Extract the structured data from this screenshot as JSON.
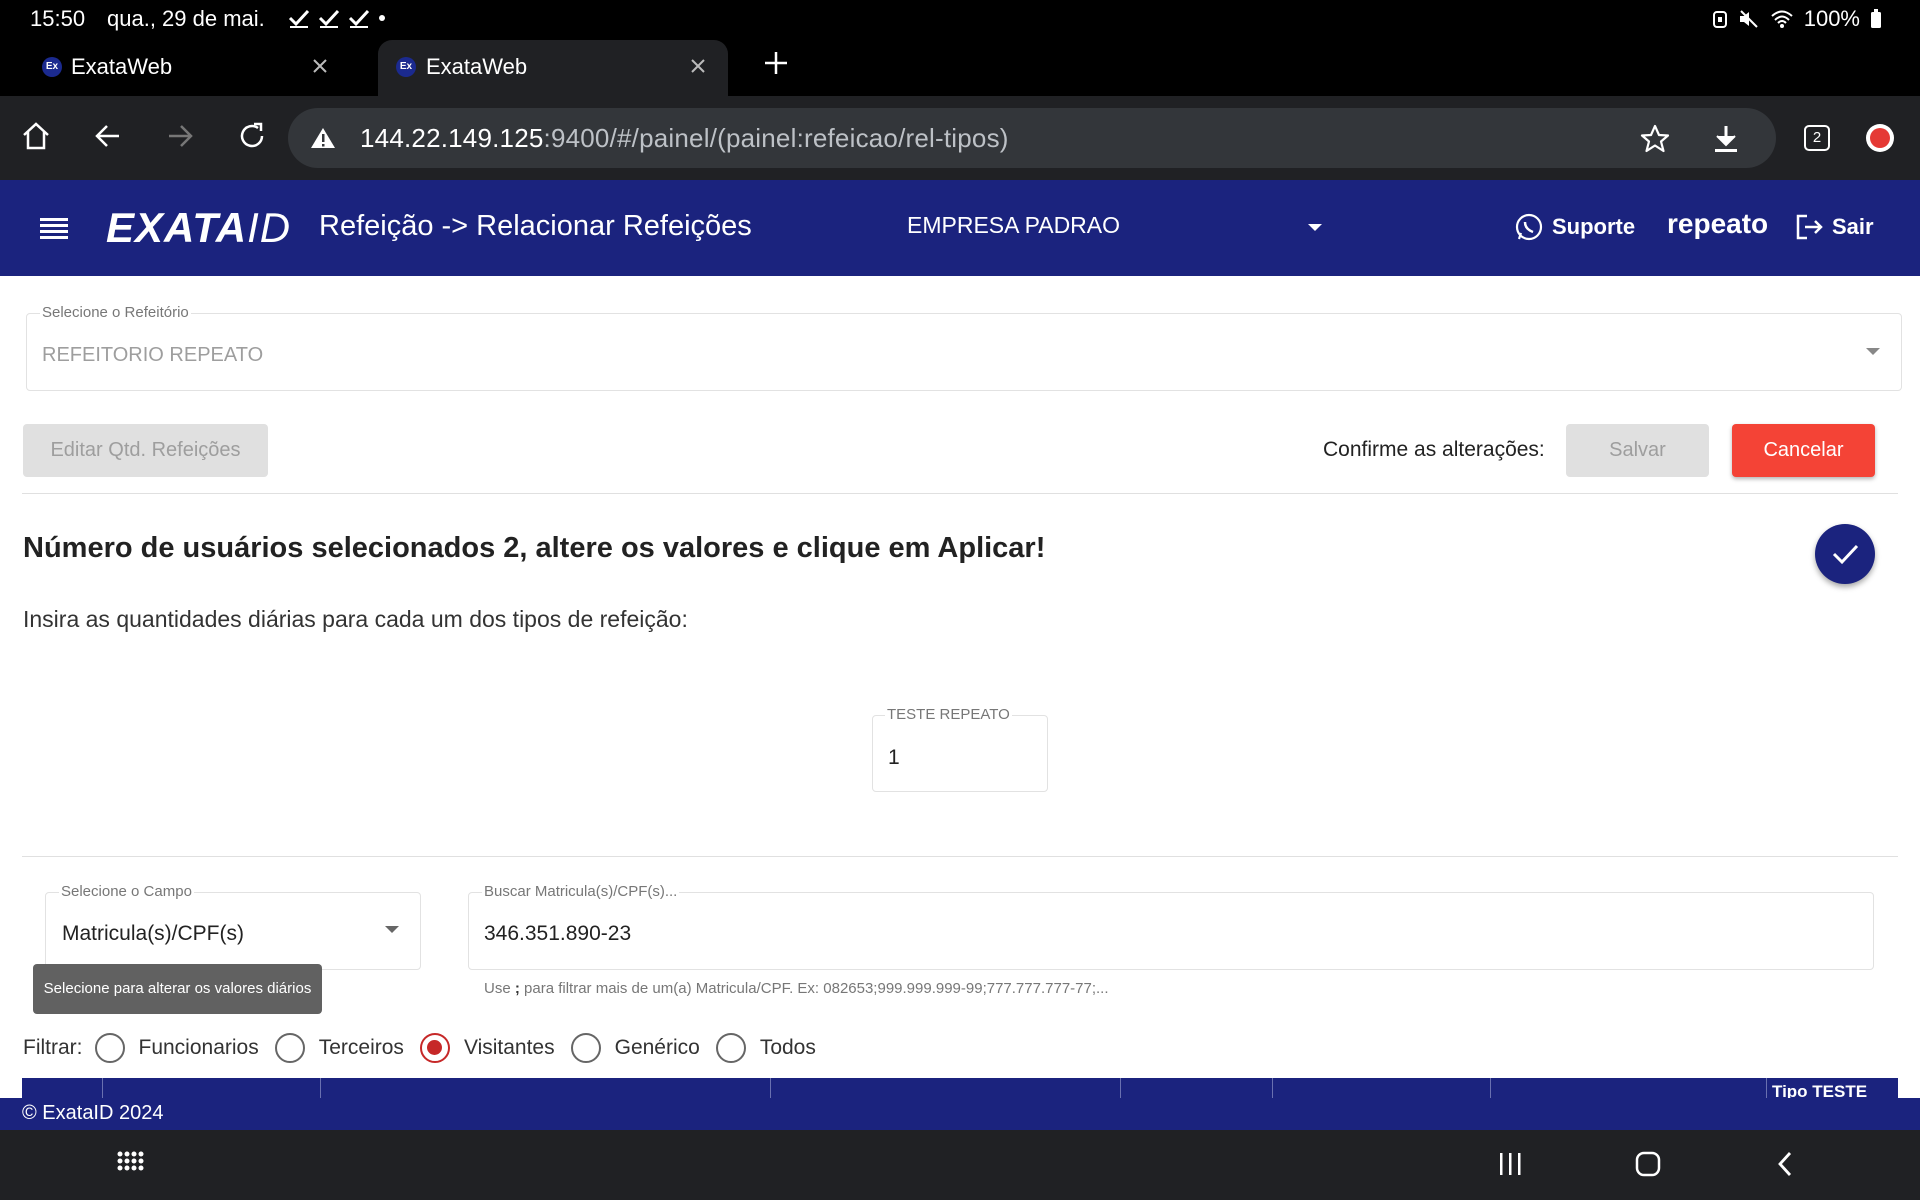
{
  "status_bar": {
    "time": "15:50",
    "date": "qua., 29 de mai.",
    "battery": "100%"
  },
  "browser": {
    "tabs": [
      {
        "title": "ExataWeb",
        "favicon": "Ex"
      },
      {
        "title": "ExataWeb",
        "favicon": "Ex"
      }
    ],
    "url_host": "144.22.149.125",
    "url_rest": ":9400/#/painel/(painel:refeicao/rel-tipos)",
    "tab_count": "2"
  },
  "header": {
    "logo": "EXATAID",
    "page_title": "Refeição -> Relacionar Refeições",
    "company": "EMPRESA PADRAO",
    "support_label": "Suporte",
    "username": "repeato",
    "logout_label": "Sair"
  },
  "refeitorio": {
    "label": "Selecione o Refeitório",
    "value": "REFEITORIO REPEATO"
  },
  "actions": {
    "edit_label": "Editar Qtd. Refeições",
    "confirm_text": "Confirme as alterações:",
    "save_label": "Salvar",
    "cancel_label": "Cancelar"
  },
  "content": {
    "heading": "Número de usuários selecionados 2, altere os valores e clique em Aplicar!",
    "subheading": "Insira as quantidades diárias para cada um dos tipos de refeição:",
    "quantity_label": "TESTE REPEATO",
    "quantity_value": "1"
  },
  "search": {
    "field_label": "Selecione o Campo",
    "field_value": "Matricula(s)/CPF(s)",
    "query_label": "Buscar Matricula(s)/CPF(s)...",
    "query_value": "346.351.890-23",
    "hint_prefix": "Use ",
    "hint_sep": ";",
    "hint_suffix": " para filtrar mais de um(a) Matricula/CPF. Ex: 082653;999.999.999-99;777.777.777-77;...",
    "tooltip": "Selecione para alterar os valores diários"
  },
  "filter": {
    "label": "Filtrar:",
    "options": [
      {
        "label": "Funcionarios",
        "selected": false
      },
      {
        "label": "Terceiros",
        "selected": false
      },
      {
        "label": "Visitantes",
        "selected": true
      },
      {
        "label": "Genérico",
        "selected": false
      },
      {
        "label": "Todos",
        "selected": false
      }
    ]
  },
  "table": {
    "last_column": "Tipo TESTE"
  },
  "footer": {
    "copyright": "© ExataID 2024"
  },
  "colors": {
    "primary": "#1b237e",
    "danger": "#f44336",
    "radio_selected": "#c62828"
  }
}
